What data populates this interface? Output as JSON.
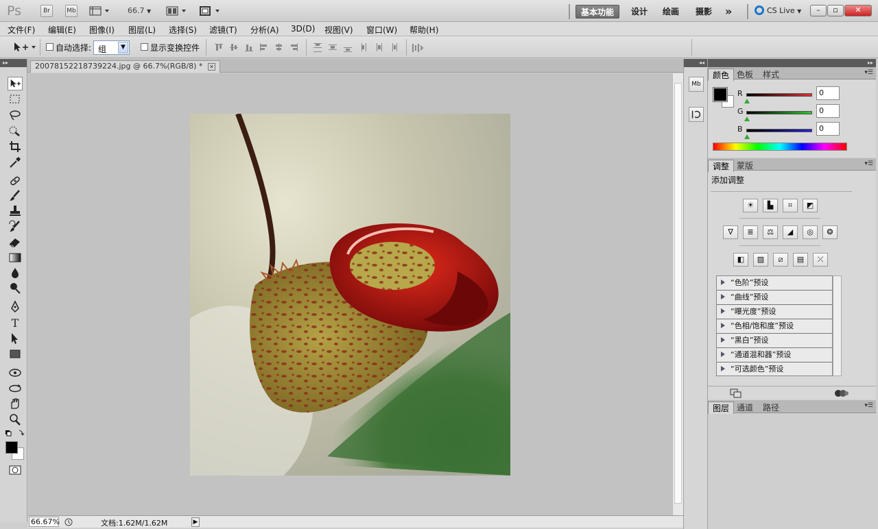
{
  "appbar": {
    "logo": "Ps",
    "br_label": "Br",
    "mb_label": "Mb",
    "zoom_value": "66.7",
    "workspaces": [
      "基本功能",
      "设计",
      "绘画",
      "摄影"
    ],
    "more": "»",
    "cs_live": "CS Live",
    "win_min": "–",
    "win_max": "▫",
    "win_close": "✕"
  },
  "menu": [
    "文件(F)",
    "编辑(E)",
    "图像(I)",
    "图层(L)",
    "选择(S)",
    "滤镜(T)",
    "分析(A)",
    "3D(D)",
    "视图(V)",
    "窗口(W)",
    "帮助(H)"
  ],
  "options": {
    "auto_select_label": "自动选择:",
    "auto_select_value": "组",
    "show_transform_label": "显示变换控件"
  },
  "document": {
    "tab_title": "20078152218739224.jpg @ 66.7%(RGB/8) *",
    "tab_close": "✕"
  },
  "status": {
    "zoom": "66.67%",
    "doc_info": "文档:1.62M/1.62M",
    "arrow": "▶"
  },
  "color_panel": {
    "tabs": [
      "颜色",
      "色板",
      "样式"
    ],
    "channels": [
      {
        "label": "R",
        "value": "0",
        "color": "#e03030"
      },
      {
        "label": "G",
        "value": "0",
        "color": "#2ec62e"
      },
      {
        "label": "B",
        "value": "0",
        "color": "#2424d8"
      }
    ]
  },
  "adjust_panel": {
    "tabs": [
      "调整",
      "蒙版"
    ],
    "title": "添加调整",
    "presets": [
      "“色阶”预设",
      "“曲线”预设",
      "“曝光度”预设",
      "“色相/饱和度”预设",
      "“黑白”预设",
      "“通道混和器”预设",
      "“可选颜色”预设"
    ]
  },
  "layers_panel": {
    "tabs": [
      "图层",
      "通道",
      "路径"
    ]
  },
  "accent": {
    "active_workspace": "#707070",
    "cs_live_ring": "#1a75c8"
  }
}
